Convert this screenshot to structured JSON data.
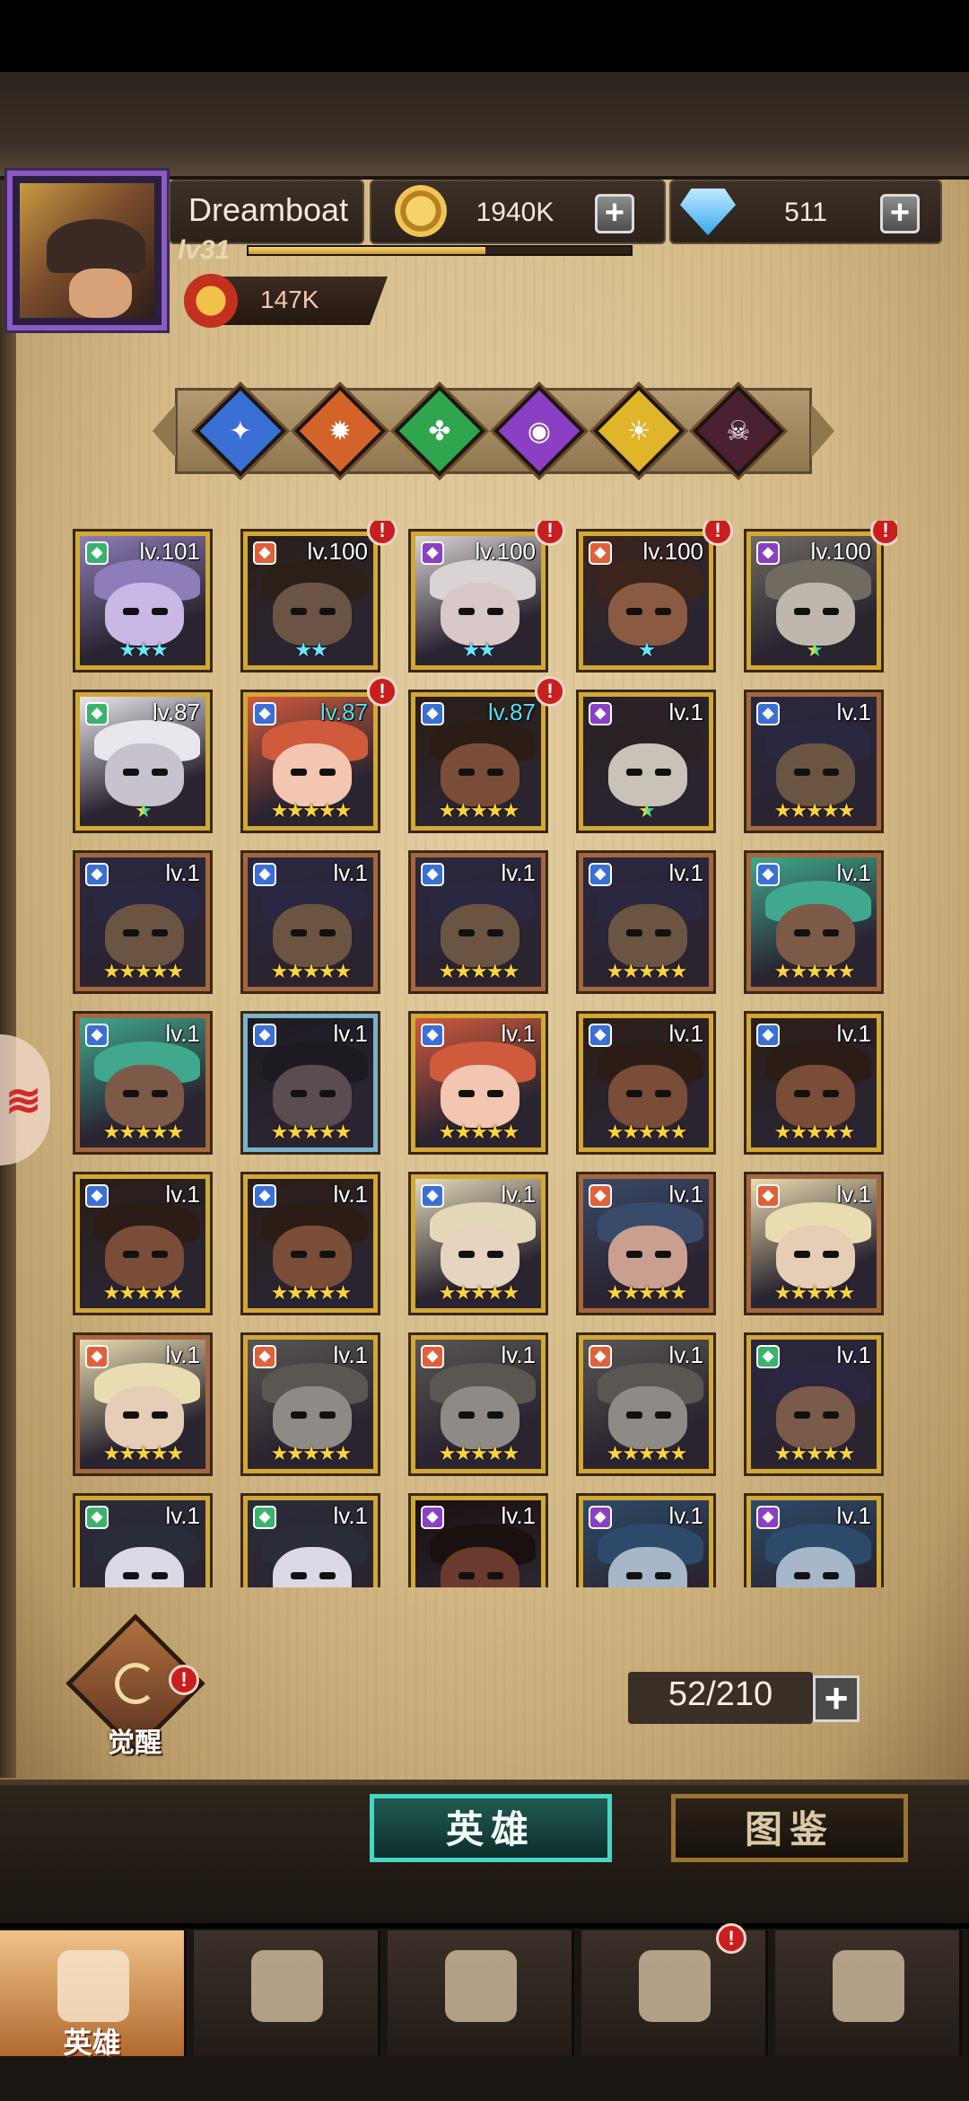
{
  "player": {
    "name": "Dreamboat",
    "level": "lv31",
    "power": "147K",
    "xp_fraction": 0.62
  },
  "resources": {
    "gold": "1940K",
    "gems": "511"
  },
  "factions": [
    {
      "icon": "dragonfly-faction-icon",
      "color": "#3a6fd6"
    },
    {
      "icon": "gear-faction-icon",
      "color": "#d4622b"
    },
    {
      "icon": "clover-faction-icon",
      "color": "#2fa64e"
    },
    {
      "icon": "eye-faction-icon",
      "color": "#8a3fc4"
    },
    {
      "icon": "sun-faction-icon",
      "color": "#e0b52a"
    },
    {
      "icon": "skull-faction-icon",
      "color": "#4a2032"
    }
  ],
  "heroes": [
    {
      "level": "lv.101",
      "stars": 3,
      "star_color": "cyan",
      "alert": false,
      "frame": "gold",
      "skin": "#c7b8e6",
      "hair": "#8e7db8",
      "cls_color": "#39b36b",
      "level_color": "white"
    },
    {
      "level": "lv.100",
      "stars": 2,
      "star_color": "cyan",
      "alert": true,
      "frame": "gold",
      "skin": "#6b5446",
      "hair": "#2a2018",
      "cls_color": "#e0603a",
      "level_color": "white"
    },
    {
      "level": "lv.100",
      "stars": 2,
      "star_color": "cyan",
      "alert": true,
      "frame": "gold",
      "skin": "#d8c8c8",
      "hair": "#d9d3d3",
      "cls_color": "#8a3fc4",
      "level_color": "white"
    },
    {
      "level": "lv.100",
      "stars": 1,
      "star_color": "cyan",
      "alert": true,
      "frame": "gold",
      "skin": "#8a5a42",
      "hair": "#3b241b",
      "cls_color": "#e0603a",
      "level_color": "white"
    },
    {
      "level": "lv.100",
      "stars": 1,
      "star_color": "rainbow",
      "alert": true,
      "frame": "gold",
      "skin": "#bdb7ad",
      "hair": "#706a60",
      "cls_color": "#8a3fc4",
      "level_color": "white"
    },
    {
      "level": "lv.87",
      "stars": 1,
      "star_color": "rainbow",
      "alert": false,
      "frame": "gold",
      "skin": "#c8c2cc",
      "hair": "#e9e6ec",
      "cls_color": "#39b36b",
      "level_color": "white"
    },
    {
      "level": "lv.87",
      "stars": 5,
      "star_color": "gold",
      "alert": true,
      "frame": "gold",
      "skin": "#f2c6b0",
      "hair": "#d05a3c",
      "cls_color": "#3a6fd6",
      "level_color": "cyan"
    },
    {
      "level": "lv.87",
      "stars": 5,
      "star_color": "gold",
      "alert": true,
      "frame": "gold",
      "skin": "#7a4d38",
      "hair": "#2b1d16",
      "cls_color": "#3a6fd6",
      "level_color": "cyan"
    },
    {
      "level": "lv.1",
      "stars": 1,
      "star_color": "rainbow",
      "alert": false,
      "frame": "gold",
      "skin": "#c9c2b8",
      "hair": "#2a2124",
      "cls_color": "#8a3fc4",
      "level_color": "white"
    },
    {
      "level": "lv.1",
      "stars": 5,
      "star_color": "gold",
      "alert": false,
      "frame": "bronze",
      "skin": "#6b5442",
      "hair": "#2a2740",
      "cls_color": "#3a6fd6",
      "level_color": "white"
    },
    {
      "level": "lv.1",
      "stars": 5,
      "star_color": "gold",
      "alert": false,
      "frame": "bronze",
      "skin": "#6b5442",
      "hair": "#2a2740",
      "cls_color": "#3a6fd6",
      "level_color": "white"
    },
    {
      "level": "lv.1",
      "stars": 5,
      "star_color": "gold",
      "alert": false,
      "frame": "bronze",
      "skin": "#6b5442",
      "hair": "#2a2740",
      "cls_color": "#3a6fd6",
      "level_color": "white"
    },
    {
      "level": "lv.1",
      "stars": 5,
      "star_color": "gold",
      "alert": false,
      "frame": "bronze",
      "skin": "#6b5442",
      "hair": "#2a2740",
      "cls_color": "#3a6fd6",
      "level_color": "white"
    },
    {
      "level": "lv.1",
      "stars": 5,
      "star_color": "gold",
      "alert": false,
      "frame": "bronze",
      "skin": "#6b5442",
      "hair": "#2a2740",
      "cls_color": "#3a6fd6",
      "level_color": "white"
    },
    {
      "level": "lv.1",
      "stars": 5,
      "star_color": "gold",
      "alert": false,
      "frame": "bronze",
      "skin": "#7d5a48",
      "hair": "#3fa88d",
      "cls_color": "#3a6fd6",
      "level_color": "white"
    },
    {
      "level": "lv.1",
      "stars": 5,
      "star_color": "gold",
      "alert": false,
      "frame": "bronze",
      "skin": "#7d5a48",
      "hair": "#3fa88d",
      "cls_color": "#3a6fd6",
      "level_color": "white"
    },
    {
      "level": "lv.1",
      "stars": 5,
      "star_color": "gold",
      "alert": false,
      "frame": "blue",
      "skin": "#5b4c52",
      "hair": "#1e1a22",
      "cls_color": "#3a6fd6",
      "level_color": "white"
    },
    {
      "level": "lv.1",
      "stars": 5,
      "star_color": "gold",
      "alert": false,
      "frame": "gold",
      "skin": "#f2c6b0",
      "hair": "#d05a3c",
      "cls_color": "#3a6fd6",
      "level_color": "white"
    },
    {
      "level": "lv.1",
      "stars": 5,
      "star_color": "gold",
      "alert": false,
      "frame": "gold",
      "skin": "#7a4d38",
      "hair": "#2b1d16",
      "cls_color": "#3a6fd6",
      "level_color": "white"
    },
    {
      "level": "lv.1",
      "stars": 5,
      "star_color": "gold",
      "alert": false,
      "frame": "gold",
      "skin": "#7a4d38",
      "hair": "#2b1d16",
      "cls_color": "#3a6fd6",
      "level_color": "white"
    },
    {
      "level": "lv.1",
      "stars": 5,
      "star_color": "gold",
      "alert": false,
      "frame": "gold",
      "skin": "#7a4d38",
      "hair": "#2b1d16",
      "cls_color": "#3a6fd6",
      "level_color": "white"
    },
    {
      "level": "lv.1",
      "stars": 5,
      "star_color": "gold",
      "alert": false,
      "frame": "gold",
      "skin": "#7a4d38",
      "hair": "#2b1d16",
      "cls_color": "#3a6fd6",
      "level_color": "white"
    },
    {
      "level": "lv.1",
      "stars": 5,
      "star_color": "gold",
      "alert": false,
      "frame": "gold",
      "skin": "#e6d3c0",
      "hair": "#e3d9b8",
      "cls_color": "#3a6fd6",
      "level_color": "white"
    },
    {
      "level": "lv.1",
      "stars": 5,
      "star_color": "gold",
      "alert": false,
      "frame": "bronze",
      "skin": "#c9a090",
      "hair": "#3a4a6a",
      "cls_color": "#e0603a",
      "level_color": "white"
    },
    {
      "level": "lv.1",
      "stars": 5,
      "star_color": "gold",
      "alert": false,
      "frame": "bronze",
      "skin": "#e6cdb5",
      "hair": "#e9dcb0",
      "cls_color": "#e0603a",
      "level_color": "white"
    },
    {
      "level": "lv.1",
      "stars": 5,
      "star_color": "gold",
      "alert": false,
      "frame": "bronze",
      "skin": "#e6cdb5",
      "hair": "#e9dcb0",
      "cls_color": "#e0603a",
      "level_color": "white"
    },
    {
      "level": "lv.1",
      "stars": 5,
      "star_color": "gold",
      "alert": false,
      "frame": "gold",
      "skin": "#8f8a86",
      "hair": "#5a5652",
      "cls_color": "#e0603a",
      "level_color": "white"
    },
    {
      "level": "lv.1",
      "stars": 5,
      "star_color": "gold",
      "alert": false,
      "frame": "gold",
      "skin": "#8f8a86",
      "hair": "#5a5652",
      "cls_color": "#e0603a",
      "level_color": "white"
    },
    {
      "level": "lv.1",
      "stars": 5,
      "star_color": "gold",
      "alert": false,
      "frame": "gold",
      "skin": "#8f8a86",
      "hair": "#5a5652",
      "cls_color": "#e0603a",
      "level_color": "white"
    },
    {
      "level": "lv.1",
      "stars": 5,
      "star_color": "gold",
      "alert": false,
      "frame": "gold",
      "skin": "#7a5a48",
      "hair": "#2a2640",
      "cls_color": "#39b36b",
      "level_color": "white"
    },
    {
      "level": "lv.1",
      "stars": 0,
      "star_color": "gold",
      "alert": false,
      "frame": "gold",
      "skin": "#dcd8e6",
      "hair": "#2a2c3a",
      "cls_color": "#39b36b",
      "level_color": "white"
    },
    {
      "level": "lv.1",
      "stars": 0,
      "star_color": "gold",
      "alert": false,
      "frame": "gold",
      "skin": "#dcd8e6",
      "hair": "#2a2c3a",
      "cls_color": "#39b36b",
      "level_color": "white"
    },
    {
      "level": "lv.1",
      "stars": 0,
      "star_color": "gold",
      "alert": false,
      "frame": "gold",
      "skin": "#6a3a2e",
      "hair": "#1a1010",
      "cls_color": "#8a3fc4",
      "level_color": "white"
    },
    {
      "level": "lv.1",
      "stars": 0,
      "star_color": "gold",
      "alert": false,
      "frame": "gold",
      "skin": "#a7b7c9",
      "hair": "#2d4a6a",
      "cls_color": "#8a3fc4",
      "level_color": "white"
    },
    {
      "level": "lv.1",
      "stars": 0,
      "star_color": "gold",
      "alert": false,
      "frame": "gold",
      "skin": "#a7b7c9",
      "hair": "#2d4a6a",
      "cls_color": "#8a3fc4",
      "level_color": "white"
    }
  ],
  "awaken": {
    "label": "觉醒",
    "alert": "!"
  },
  "roster": {
    "count": "52/210"
  },
  "segments": {
    "heroes": "英雄",
    "gallery": "图鉴"
  },
  "nav": [
    {
      "label": "英雄",
      "icon": "helmet-icon",
      "active": true,
      "alert": false
    },
    {
      "label": "",
      "icon": "map-scroll-icon",
      "active": false,
      "alert": false
    },
    {
      "label": "",
      "icon": "crossed-swords-icon",
      "active": false,
      "alert": false
    },
    {
      "label": "",
      "icon": "castle-icon",
      "active": false,
      "alert": true
    },
    {
      "label": "",
      "icon": "guild-handshake-icon",
      "active": false,
      "alert": false
    }
  ],
  "alert_mark": "!",
  "plus_mark": "+"
}
